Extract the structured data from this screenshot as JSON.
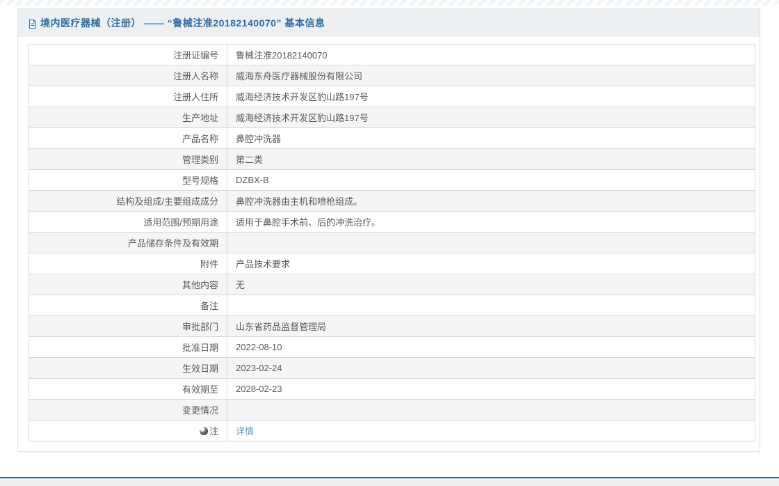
{
  "header": {
    "title": "境内医疗器械（注册） —— “鲁械注准20182140070” 基本信息",
    "icon": "document-icon",
    "title_color": "#2e6da4"
  },
  "table": {
    "rows": [
      {
        "label": "注册证编号",
        "value": "鲁械注准20182140070"
      },
      {
        "label": "注册人名称",
        "value": "威海东舟医疗器械股份有限公司"
      },
      {
        "label": "注册人住所",
        "value": "威海经济技术开发区豹山路197号"
      },
      {
        "label": "生产地址",
        "value": "威海经济技术开发区豹山路197号"
      },
      {
        "label": "产品名称",
        "value": "鼻腔冲洗器"
      },
      {
        "label": "管理类别",
        "value": "第二类"
      },
      {
        "label": "型号规格",
        "value": "DZBX-B"
      },
      {
        "label": "结构及组成/主要组成成分",
        "value": "鼻腔冲洗器由主机和喷枪组成。"
      },
      {
        "label": "适用范围/预期用途",
        "value": "适用于鼻腔手术前、后的冲洗治疗。"
      },
      {
        "label": "产品储存条件及有效期",
        "value": ""
      },
      {
        "label": "附件",
        "value": "产品技术要求"
      },
      {
        "label": "其他内容",
        "value": "无"
      },
      {
        "label": "备注",
        "value": ""
      },
      {
        "label": "审批部门",
        "value": "山东省药品监督管理局"
      },
      {
        "label": "批准日期",
        "value": "2022-08-10"
      },
      {
        "label": "生效日期",
        "value": "2023-02-24"
      },
      {
        "label": "有效期至",
        "value": "2028-02-23"
      },
      {
        "label": "变更情况",
        "value": ""
      },
      {
        "label": "注",
        "value": "详情",
        "link": true,
        "icon": "sphere-icon",
        "link_color": "#5b9bd5"
      }
    ]
  },
  "colors": {
    "accent_blue": "#2e6da4",
    "link_blue": "#5b9bd5",
    "row_stripe": "#f5f5f5",
    "border": "#d9d9d9",
    "header_strip": "#edf0f2",
    "footer_line": "#2563a0",
    "footer_bg": "#efefef"
  }
}
